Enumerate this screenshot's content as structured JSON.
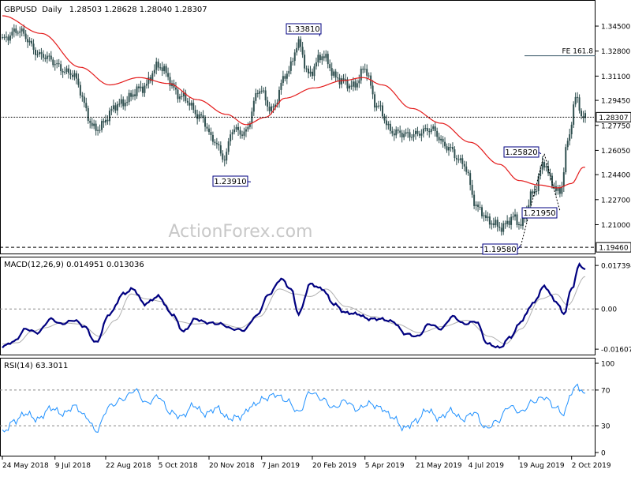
{
  "header": {
    "symbol": "GBPUSD",
    "timeframe": "Daily",
    "ohlc": "1.28503 1.28628 1.28040 1.28307"
  },
  "watermark": "ActionForex.com",
  "colors": {
    "candle": "#2f4f4f",
    "ma": "#e41b1b",
    "macd": "#000080",
    "signal": "#b0b0b0",
    "rsi": "#1e90ff",
    "annotation": "#000080",
    "grid": "#000000"
  },
  "chart_data": [
    {
      "type": "candlestick",
      "title": "GBPUSD Daily",
      "x_tick_labels": [
        "24 May 2018",
        "9 Jul 2018",
        "22 Aug 2018",
        "5 Oct 2018",
        "20 Nov 2018",
        "7 Jan 2019",
        "20 Feb 2019",
        "5 Apr 2019",
        "21 May 2019",
        "4 Jul 2019",
        "19 Aug 2019",
        "2 Oct 2019"
      ],
      "y_tick_labels": [
        "1.34500",
        "1.32800",
        "1.31100",
        "1.29450",
        "1.27750",
        "1.26050",
        "1.24400",
        "1.22700",
        "1.21000"
      ],
      "ylim": [
        1.192,
        1.352
      ],
      "price_anchors": [
        {
          "idx": 0,
          "close": 1.336
        },
        {
          "idx": 8,
          "close": 1.342
        },
        {
          "idx": 20,
          "close": 1.325
        },
        {
          "idx": 35,
          "close": 1.313
        },
        {
          "idx": 48,
          "close": 1.275
        },
        {
          "idx": 60,
          "close": 1.292
        },
        {
          "idx": 72,
          "close": 1.303
        },
        {
          "idx": 80,
          "close": 1.318
        },
        {
          "idx": 92,
          "close": 1.297
        },
        {
          "idx": 102,
          "close": 1.283
        },
        {
          "idx": 108,
          "close": 1.268
        },
        {
          "idx": 114,
          "close": 1.255
        },
        {
          "idx": 118,
          "close": 1.275
        },
        {
          "idx": 124,
          "close": 1.272
        },
        {
          "idx": 132,
          "close": 1.302
        },
        {
          "idx": 138,
          "close": 1.288
        },
        {
          "idx": 146,
          "close": 1.313
        },
        {
          "idx": 152,
          "close": 1.333
        },
        {
          "idx": 157,
          "close": 1.312
        },
        {
          "idx": 164,
          "close": 1.325
        },
        {
          "idx": 172,
          "close": 1.309
        },
        {
          "idx": 180,
          "close": 1.304
        },
        {
          "idx": 186,
          "close": 1.316
        },
        {
          "idx": 192,
          "close": 1.291
        },
        {
          "idx": 200,
          "close": 1.273
        },
        {
          "idx": 210,
          "close": 1.271
        },
        {
          "idx": 220,
          "close": 1.275
        },
        {
          "idx": 228,
          "close": 1.263
        },
        {
          "idx": 236,
          "close": 1.252
        },
        {
          "idx": 244,
          "close": 1.221
        },
        {
          "idx": 250,
          "close": 1.212
        },
        {
          "idx": 256,
          "close": 1.208
        },
        {
          "idx": 262,
          "close": 1.215
        },
        {
          "idx": 266,
          "close": 1.21
        },
        {
          "idx": 272,
          "close": 1.231
        },
        {
          "idx": 278,
          "close": 1.252
        },
        {
          "idx": 282,
          "close": 1.238
        },
        {
          "idx": 286,
          "close": 1.231
        },
        {
          "idx": 290,
          "close": 1.266
        },
        {
          "idx": 294,
          "close": 1.296
        },
        {
          "idx": 298,
          "close": 1.283
        }
      ],
      "moving_average": {
        "color": "#e41b1b",
        "anchors": [
          {
            "idx": 0,
            "value": 1.352
          },
          {
            "idx": 20,
            "value": 1.34
          },
          {
            "idx": 40,
            "value": 1.317
          },
          {
            "idx": 55,
            "value": 1.305
          },
          {
            "idx": 70,
            "value": 1.31
          },
          {
            "idx": 85,
            "value": 1.306
          },
          {
            "idx": 100,
            "value": 1.295
          },
          {
            "idx": 115,
            "value": 1.285
          },
          {
            "idx": 125,
            "value": 1.278
          },
          {
            "idx": 135,
            "value": 1.283
          },
          {
            "idx": 145,
            "value": 1.296
          },
          {
            "idx": 160,
            "value": 1.303
          },
          {
            "idx": 175,
            "value": 1.308
          },
          {
            "idx": 185,
            "value": 1.31
          },
          {
            "idx": 195,
            "value": 1.305
          },
          {
            "idx": 210,
            "value": 1.289
          },
          {
            "idx": 225,
            "value": 1.279
          },
          {
            "idx": 240,
            "value": 1.266
          },
          {
            "idx": 255,
            "value": 1.251
          },
          {
            "idx": 265,
            "value": 1.24
          },
          {
            "idx": 275,
            "value": 1.237
          },
          {
            "idx": 285,
            "value": 1.235
          },
          {
            "idx": 292,
            "value": 1.238
          },
          {
            "idx": 298,
            "value": 1.249
          }
        ]
      },
      "horizontal_lines": [
        {
          "label": "1.19460",
          "value": 1.1946,
          "style": "dashed"
        },
        {
          "label": "1.28307",
          "value": 1.28307,
          "style": "solid"
        },
        {
          "label": "FE 161.8",
          "value": 1.3248,
          "style": "solid"
        }
      ],
      "annotations": [
        {
          "text": "1.33810",
          "value": 1.3381
        },
        {
          "text": "1.23910",
          "value": 1.2391
        },
        {
          "text": "1.25820",
          "value": 1.2582
        },
        {
          "text": "1.21950",
          "value": 1.2195
        },
        {
          "text": "1.19580",
          "value": 1.1958
        }
      ],
      "fib_projection_path": [
        {
          "idx": 266,
          "value": 1.1958
        },
        {
          "idx": 278,
          "value": 1.2582
        },
        {
          "idx": 286,
          "value": 1.2195
        }
      ]
    },
    {
      "type": "line",
      "title": "MACD(12,26,9) 0.014951 0.013036",
      "y_tick_labels": [
        "0.017394",
        "0.00",
        "-0.016078"
      ],
      "ylim": [
        -0.0173,
        0.0187
      ],
      "series": [
        {
          "name": "MACD",
          "color": "#000080",
          "anchors": [
            {
              "idx": 0,
              "value": -0.015
            },
            {
              "idx": 6,
              "value": -0.013
            },
            {
              "idx": 12,
              "value": -0.008
            },
            {
              "idx": 18,
              "value": -0.0095
            },
            {
              "idx": 25,
              "value": -0.004
            },
            {
              "idx": 30,
              "value": -0.006
            },
            {
              "idx": 37,
              "value": -0.0045
            },
            {
              "idx": 42,
              "value": -0.007
            },
            {
              "idx": 48,
              "value": -0.0135
            },
            {
              "idx": 55,
              "value": -0.002
            },
            {
              "idx": 62,
              "value": 0.006
            },
            {
              "idx": 67,
              "value": 0.008
            },
            {
              "idx": 73,
              "value": 0.002
            },
            {
              "idx": 80,
              "value": 0.005
            },
            {
              "idx": 87,
              "value": -0.002
            },
            {
              "idx": 93,
              "value": -0.009
            },
            {
              "idx": 99,
              "value": -0.004
            },
            {
              "idx": 105,
              "value": -0.0055
            },
            {
              "idx": 112,
              "value": -0.006
            },
            {
              "idx": 118,
              "value": -0.008
            },
            {
              "idx": 124,
              "value": -0.0085
            },
            {
              "idx": 130,
              "value": -0.003
            },
            {
              "idx": 137,
              "value": 0.006
            },
            {
              "idx": 143,
              "value": 0.012
            },
            {
              "idx": 148,
              "value": 0.008
            },
            {
              "idx": 152,
              "value": -0.002
            },
            {
              "idx": 158,
              "value": 0.01
            },
            {
              "idx": 164,
              "value": 0.008
            },
            {
              "idx": 170,
              "value": 0.002
            },
            {
              "idx": 176,
              "value": -0.0015
            },
            {
              "idx": 182,
              "value": -0.002
            },
            {
              "idx": 188,
              "value": -0.004
            },
            {
              "idx": 194,
              "value": -0.004
            },
            {
              "idx": 200,
              "value": -0.005
            },
            {
              "idx": 207,
              "value": -0.01
            },
            {
              "idx": 213,
              "value": -0.011
            },
            {
              "idx": 219,
              "value": -0.006
            },
            {
              "idx": 225,
              "value": -0.008
            },
            {
              "idx": 231,
              "value": -0.003
            },
            {
              "idx": 237,
              "value": -0.006
            },
            {
              "idx": 243,
              "value": -0.005
            },
            {
              "idx": 249,
              "value": -0.014
            },
            {
              "idx": 255,
              "value": -0.0155
            },
            {
              "idx": 261,
              "value": -0.011
            },
            {
              "idx": 266,
              "value": -0.005
            },
            {
              "idx": 272,
              "value": 0.002
            },
            {
              "idx": 278,
              "value": 0.009
            },
            {
              "idx": 284,
              "value": 0.003
            },
            {
              "idx": 288,
              "value": -0.002
            },
            {
              "idx": 292,
              "value": 0.008
            },
            {
              "idx": 296,
              "value": 0.0175
            },
            {
              "idx": 299,
              "value": 0.016
            }
          ]
        },
        {
          "name": "Signal",
          "color": "#b0b0b0",
          "anchors": [
            {
              "idx": 0,
              "value": -0.014
            },
            {
              "idx": 8,
              "value": -0.0135
            },
            {
              "idx": 15,
              "value": -0.009
            },
            {
              "idx": 22,
              "value": -0.0075
            },
            {
              "idx": 30,
              "value": -0.0055
            },
            {
              "idx": 40,
              "value": -0.006
            },
            {
              "idx": 50,
              "value": -0.011
            },
            {
              "idx": 58,
              "value": -0.0045
            },
            {
              "idx": 66,
              "value": 0.006
            },
            {
              "idx": 74,
              "value": 0.004
            },
            {
              "idx": 82,
              "value": 0.003
            },
            {
              "idx": 90,
              "value": -0.005
            },
            {
              "idx": 98,
              "value": -0.006
            },
            {
              "idx": 110,
              "value": -0.0055
            },
            {
              "idx": 122,
              "value": -0.0075
            },
            {
              "idx": 132,
              "value": -0.003
            },
            {
              "idx": 142,
              "value": 0.008
            },
            {
              "idx": 150,
              "value": 0.006
            },
            {
              "idx": 158,
              "value": 0.005
            },
            {
              "idx": 166,
              "value": 0.008
            },
            {
              "idx": 176,
              "value": 0.001
            },
            {
              "idx": 190,
              "value": -0.003
            },
            {
              "idx": 202,
              "value": -0.006
            },
            {
              "idx": 214,
              "value": -0.0095
            },
            {
              "idx": 226,
              "value": -0.007
            },
            {
              "idx": 238,
              "value": -0.0045
            },
            {
              "idx": 250,
              "value": -0.011
            },
            {
              "idx": 258,
              "value": -0.014
            },
            {
              "idx": 266,
              "value": -0.008
            },
            {
              "idx": 276,
              "value": 0.004
            },
            {
              "idx": 284,
              "value": 0.006
            },
            {
              "idx": 290,
              "value": 0.0015
            },
            {
              "idx": 299,
              "value": 0.013
            }
          ]
        }
      ]
    },
    {
      "type": "line",
      "title": "RSI(14) 63.3011",
      "y_tick_labels": [
        "100",
        "70",
        "30",
        "0"
      ],
      "ylim": [
        0,
        100
      ],
      "reference_levels": [
        70,
        30
      ],
      "series": [
        {
          "name": "RSI",
          "color": "#1e90ff",
          "anchors": [
            {
              "idx": 0,
              "value": 22
            },
            {
              "idx": 6,
              "value": 35
            },
            {
              "idx": 12,
              "value": 44
            },
            {
              "idx": 18,
              "value": 37
            },
            {
              "idx": 25,
              "value": 50
            },
            {
              "idx": 31,
              "value": 43
            },
            {
              "idx": 37,
              "value": 52
            },
            {
              "idx": 43,
              "value": 40
            },
            {
              "idx": 48,
              "value": 24
            },
            {
              "idx": 55,
              "value": 52
            },
            {
              "idx": 62,
              "value": 60
            },
            {
              "idx": 68,
              "value": 70
            },
            {
              "idx": 74,
              "value": 55
            },
            {
              "idx": 80,
              "value": 63
            },
            {
              "idx": 86,
              "value": 45
            },
            {
              "idx": 92,
              "value": 40
            },
            {
              "idx": 98,
              "value": 53
            },
            {
              "idx": 104,
              "value": 43
            },
            {
              "idx": 110,
              "value": 50
            },
            {
              "idx": 116,
              "value": 38
            },
            {
              "idx": 122,
              "value": 40
            },
            {
              "idx": 128,
              "value": 52
            },
            {
              "idx": 134,
              "value": 60
            },
            {
              "idx": 140,
              "value": 65
            },
            {
              "idx": 146,
              "value": 58
            },
            {
              "idx": 152,
              "value": 45
            },
            {
              "idx": 158,
              "value": 68
            },
            {
              "idx": 164,
              "value": 60
            },
            {
              "idx": 170,
              "value": 50
            },
            {
              "idx": 176,
              "value": 58
            },
            {
              "idx": 182,
              "value": 48
            },
            {
              "idx": 188,
              "value": 55
            },
            {
              "idx": 194,
              "value": 50
            },
            {
              "idx": 200,
              "value": 40
            },
            {
              "idx": 206,
              "value": 27
            },
            {
              "idx": 212,
              "value": 35
            },
            {
              "idx": 218,
              "value": 48
            },
            {
              "idx": 224,
              "value": 38
            },
            {
              "idx": 230,
              "value": 47
            },
            {
              "idx": 236,
              "value": 37
            },
            {
              "idx": 242,
              "value": 45
            },
            {
              "idx": 248,
              "value": 27
            },
            {
              "idx": 254,
              "value": 35
            },
            {
              "idx": 260,
              "value": 52
            },
            {
              "idx": 266,
              "value": 45
            },
            {
              "idx": 272,
              "value": 57
            },
            {
              "idx": 278,
              "value": 62
            },
            {
              "idx": 284,
              "value": 50
            },
            {
              "idx": 288,
              "value": 43
            },
            {
              "idx": 292,
              "value": 68
            },
            {
              "idx": 295,
              "value": 75
            },
            {
              "idx": 297,
              "value": 70
            },
            {
              "idx": 299,
              "value": 63
            }
          ]
        }
      ]
    }
  ]
}
